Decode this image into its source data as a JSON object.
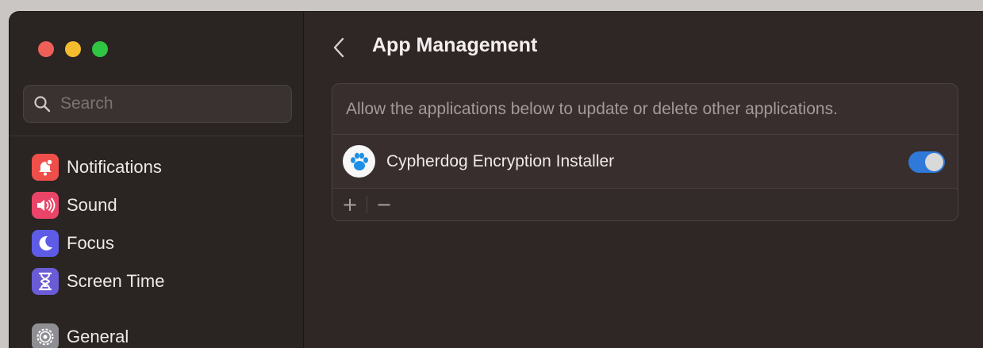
{
  "window": {
    "traffic_lights": [
      {
        "name": "close",
        "color": "#ee5f57"
      },
      {
        "name": "minimize",
        "color": "#f5bd2e"
      },
      {
        "name": "zoom",
        "color": "#2fc641"
      }
    ]
  },
  "sidebar": {
    "search_placeholder": "Search",
    "items": [
      {
        "label": "Notifications",
        "icon": "bell-badge-icon",
        "color": "#ee4f4a"
      },
      {
        "label": "Sound",
        "icon": "speaker-icon",
        "color": "#ea4468"
      },
      {
        "label": "Focus",
        "icon": "moon-icon",
        "color": "#5e5ce6"
      },
      {
        "label": "Screen Time",
        "icon": "hourglass-icon",
        "color": "#6a5cd6"
      },
      {
        "label": "General",
        "icon": "gear-icon",
        "color": "#8e8e93"
      }
    ]
  },
  "main": {
    "title": "App Management",
    "description": "Allow the applications below to update or delete other applications.",
    "apps": [
      {
        "name": "Cypherdog Encryption Installer",
        "enabled": true,
        "icon": "paw-icon"
      }
    ],
    "footer": {
      "add": "+",
      "remove": "−"
    }
  },
  "colors": {
    "accent": "#2f79d9"
  }
}
